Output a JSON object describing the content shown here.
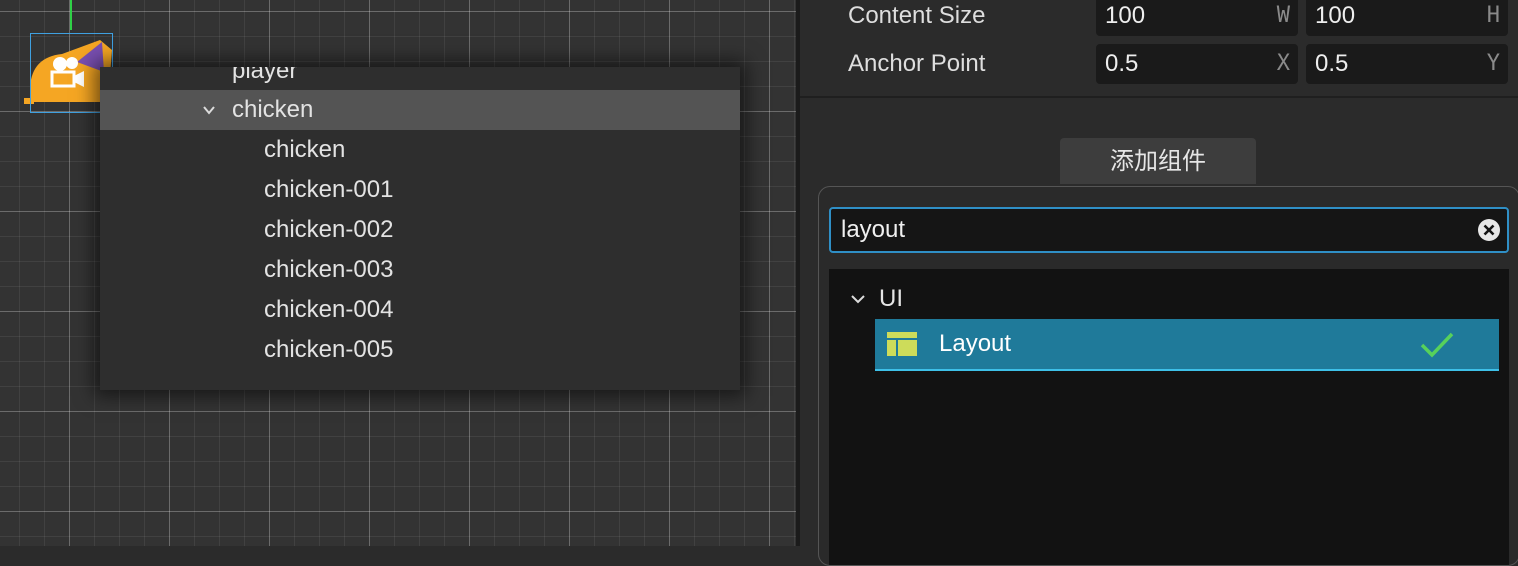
{
  "scene": {
    "node_menu": {
      "rows": [
        {
          "label": "player",
          "level": 0
        },
        {
          "label": "chicken",
          "level": 0,
          "expanded": true,
          "highlighted": true
        },
        {
          "label": "chicken",
          "level": 1
        },
        {
          "label": "chicken-001",
          "level": 1
        },
        {
          "label": "chicken-002",
          "level": 1
        },
        {
          "label": "chicken-003",
          "level": 1
        },
        {
          "label": "chicken-004",
          "level": 1
        },
        {
          "label": "chicken-005",
          "level": 1
        }
      ]
    }
  },
  "inspector": {
    "content_size": {
      "label": "Content Size",
      "w_value": "100",
      "w_suffix": "W",
      "h_value": "100",
      "h_suffix": "H"
    },
    "anchor_point": {
      "label": "Anchor Point",
      "x_value": "0.5",
      "x_suffix": "X",
      "y_value": "0.5",
      "y_suffix": "Y"
    },
    "add_component_label": "添加组件"
  },
  "component_popup": {
    "search_value": "layout",
    "group_label": "UI",
    "item_label": "Layout",
    "icons": [
      "chevron-down-icon",
      "clear-icon",
      "layout-icon",
      "checkmark-icon"
    ]
  },
  "colors": {
    "accent_blue": "#2f8fc6",
    "selected_item": "#1f7a9a",
    "check_green": "#57d15b",
    "node_orange": "#f5a623"
  }
}
